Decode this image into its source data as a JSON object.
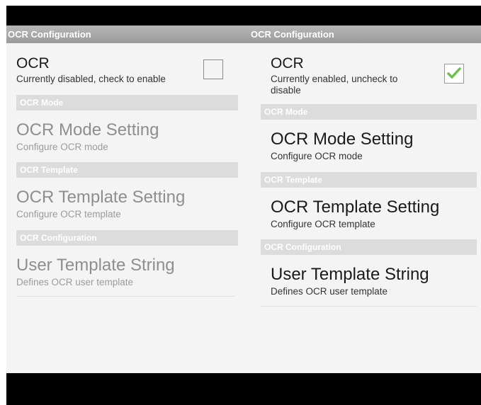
{
  "left_panel": {
    "header": "OCR Configuration",
    "ocr_toggle": {
      "title": "OCR",
      "summary": "Currently disabled, check to enable",
      "checked": false
    },
    "categories": {
      "mode": "OCR Mode",
      "template": "OCR Template",
      "configuration": "OCR Configuration"
    },
    "items": {
      "mode": {
        "title": "OCR Mode Setting",
        "summary": "Configure OCR mode"
      },
      "template": {
        "title": "OCR Template Setting",
        "summary": "Configure OCR template"
      },
      "user_template": {
        "title": "User Template String",
        "summary": "Defines OCR user template"
      }
    }
  },
  "right_panel": {
    "header": "OCR Configuration",
    "ocr_toggle": {
      "title": "OCR",
      "summary": "Currently enabled, uncheck to disable",
      "checked": true
    },
    "categories": {
      "mode": "OCR Mode",
      "template": "OCR Template",
      "configuration": "OCR Configuration"
    },
    "items": {
      "mode": {
        "title": "OCR Mode Setting",
        "summary": "Configure OCR mode"
      },
      "template": {
        "title": "OCR Template Setting",
        "summary": "Configure OCR template"
      },
      "user_template": {
        "title": "User Template String",
        "summary": "Defines OCR user template"
      }
    }
  },
  "icons": {
    "checkmark": "check-icon"
  },
  "colors": {
    "title_bar": "#a8a8a8",
    "category_bar": "#dcdcdc",
    "checkmark": "#6cc24a",
    "disabled_text": "#8e8e8e"
  }
}
